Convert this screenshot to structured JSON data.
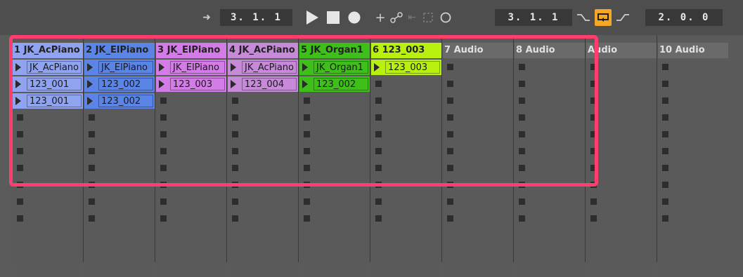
{
  "transport": {
    "arrangement_position": "3. 1. 1",
    "loop_start": "3. 1. 1",
    "loop_length": "2. 0. 0"
  },
  "colors": {
    "highlight": "#ff3d6e",
    "loop_active": "#f5a623"
  },
  "tracks": [
    {
      "name": "1 JK_AcPiano",
      "color": "#8fa3f0",
      "clips": [
        "JK_AcPiano",
        "123_001",
        "123_001"
      ]
    },
    {
      "name": "2 JK_ElPiano",
      "color": "#5a84e6",
      "clips": [
        "JK_ElPiano",
        "123_002",
        "123_002"
      ]
    },
    {
      "name": "3 JK_ElPiano",
      "color": "#d37be6",
      "clips": [
        "JK_ElPiano",
        "123_003"
      ]
    },
    {
      "name": "4 JK_AcPiano",
      "color": "#c78ad9",
      "clips": [
        "JK_AcPiano",
        "123_004"
      ]
    },
    {
      "name": "5 JK_Organ1",
      "color": "#3fbf1a",
      "clips": [
        "JK_Organ1",
        "123_002"
      ]
    },
    {
      "name": "6 123_003",
      "color": "#b8f010",
      "clips": [
        "123_003"
      ]
    },
    {
      "name": "7 Audio",
      "color": "#6a6a6a",
      "clips": []
    },
    {
      "name": "8 Audio",
      "color": "#6a6a6a",
      "clips": []
    },
    {
      "name": "Audio",
      "color": "#6a6a6a",
      "clips": []
    },
    {
      "name": "10 Audio",
      "color": "#6a6a6a",
      "clips": []
    }
  ]
}
